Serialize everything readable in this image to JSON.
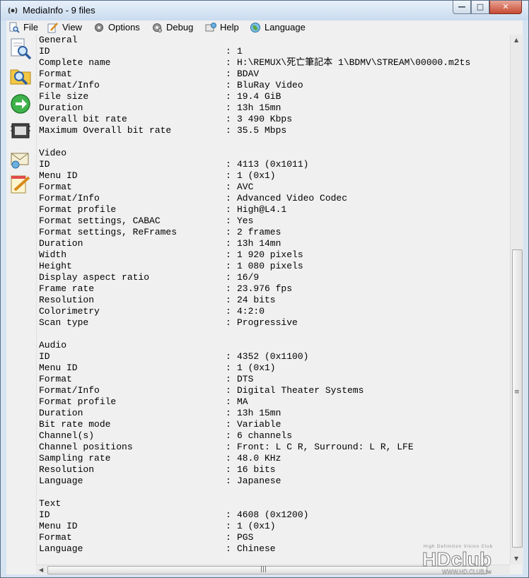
{
  "window": {
    "title": "MediaInfo - 9 files"
  },
  "menu": [
    {
      "label": "File",
      "icon": "magnifier-page-icon"
    },
    {
      "label": "View",
      "icon": "pencil-page-icon"
    },
    {
      "label": "Options",
      "icon": "gear-icon"
    },
    {
      "label": "Debug",
      "icon": "debug-gear-icon"
    },
    {
      "label": "Help",
      "icon": "help-globe-icon"
    },
    {
      "label": "Language",
      "icon": "globe-icon"
    }
  ],
  "toolbar": [
    {
      "name": "open-file-tool",
      "icon": "magnifier-page-icon"
    },
    {
      "name": "open-folder-tool",
      "icon": "folder-magnifier-icon"
    },
    {
      "name": "export-tool",
      "icon": "green-arrow-icon"
    },
    {
      "name": "debug-tool",
      "icon": "chip-icon"
    },
    {
      "name": "web-tool",
      "icon": "envelope-icon"
    },
    {
      "name": "edit-tool",
      "icon": "notepad-icon"
    }
  ],
  "report": [
    {
      "type": "section",
      "title": "General"
    },
    {
      "type": "field",
      "key": "ID",
      "value": "1"
    },
    {
      "type": "field",
      "key": "Complete name",
      "value": "H:\\REMUX\\死亡筆記本 1\\BDMV\\STREAM\\00000.m2ts"
    },
    {
      "type": "field",
      "key": "Format",
      "value": "BDAV"
    },
    {
      "type": "field",
      "key": "Format/Info",
      "value": "BluRay Video"
    },
    {
      "type": "field",
      "key": "File size",
      "value": "19.4 GiB"
    },
    {
      "type": "field",
      "key": "Duration",
      "value": "13h 15mn"
    },
    {
      "type": "field",
      "key": "Overall bit rate",
      "value": "3 490 Kbps"
    },
    {
      "type": "field",
      "key": "Maximum Overall bit rate",
      "value": "35.5 Mbps"
    },
    {
      "type": "blank"
    },
    {
      "type": "section",
      "title": "Video"
    },
    {
      "type": "field",
      "key": "ID",
      "value": "4113 (0x1011)"
    },
    {
      "type": "field",
      "key": "Menu ID",
      "value": "1 (0x1)"
    },
    {
      "type": "field",
      "key": "Format",
      "value": "AVC"
    },
    {
      "type": "field",
      "key": "Format/Info",
      "value": "Advanced Video Codec"
    },
    {
      "type": "field",
      "key": "Format profile",
      "value": "High@L4.1"
    },
    {
      "type": "field",
      "key": "Format settings, CABAC",
      "value": "Yes"
    },
    {
      "type": "field",
      "key": "Format settings, ReFrames",
      "value": "2 frames"
    },
    {
      "type": "field",
      "key": "Duration",
      "value": "13h 14mn"
    },
    {
      "type": "field",
      "key": "Width",
      "value": "1 920 pixels"
    },
    {
      "type": "field",
      "key": "Height",
      "value": "1 080 pixels"
    },
    {
      "type": "field",
      "key": "Display aspect ratio",
      "value": "16/9"
    },
    {
      "type": "field",
      "key": "Frame rate",
      "value": "23.976 fps"
    },
    {
      "type": "field",
      "key": "Resolution",
      "value": "24 bits"
    },
    {
      "type": "field",
      "key": "Colorimetry",
      "value": "4:2:0"
    },
    {
      "type": "field",
      "key": "Scan type",
      "value": "Progressive"
    },
    {
      "type": "blank"
    },
    {
      "type": "section",
      "title": "Audio"
    },
    {
      "type": "field",
      "key": "ID",
      "value": "4352 (0x1100)"
    },
    {
      "type": "field",
      "key": "Menu ID",
      "value": "1 (0x1)"
    },
    {
      "type": "field",
      "key": "Format",
      "value": "DTS"
    },
    {
      "type": "field",
      "key": "Format/Info",
      "value": "Digital Theater Systems"
    },
    {
      "type": "field",
      "key": "Format profile",
      "value": "MA"
    },
    {
      "type": "field",
      "key": "Duration",
      "value": "13h 15mn"
    },
    {
      "type": "field",
      "key": "Bit rate mode",
      "value": "Variable"
    },
    {
      "type": "field",
      "key": "Channel(s)",
      "value": "6 channels"
    },
    {
      "type": "field",
      "key": "Channel positions",
      "value": "Front: L C R, Surround: L R, LFE"
    },
    {
      "type": "field",
      "key": "Sampling rate",
      "value": "48.0 KHz"
    },
    {
      "type": "field",
      "key": "Resolution",
      "value": "16 bits"
    },
    {
      "type": "field",
      "key": "Language",
      "value": "Japanese"
    },
    {
      "type": "blank"
    },
    {
      "type": "section",
      "title": "Text"
    },
    {
      "type": "field",
      "key": "ID",
      "value": "4608 (0x1200)"
    },
    {
      "type": "field",
      "key": "Menu ID",
      "value": "1 (0x1)"
    },
    {
      "type": "field",
      "key": "Format",
      "value": "PGS"
    },
    {
      "type": "field",
      "key": "Language",
      "value": "Chinese"
    }
  ],
  "separator": ":",
  "watermark": {
    "tagline": "High Definition Vision Club",
    "logo": "HDclub",
    "url": "WWW.HD.CLUB.tw"
  },
  "colors": {
    "titlebar": "#d6e4f2",
    "close_button": "#c74a33",
    "content_bg": "#f0f0f0"
  }
}
